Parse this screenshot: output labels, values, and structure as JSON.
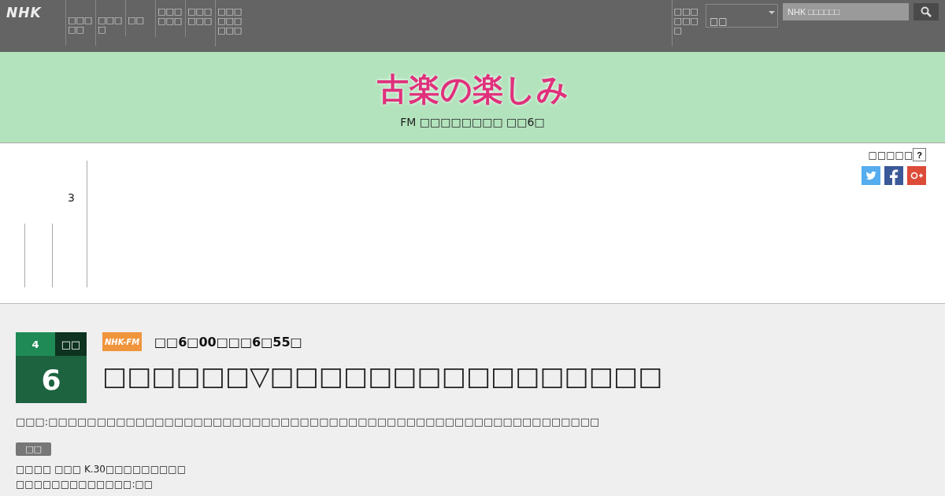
{
  "header": {
    "logo": "NHK",
    "nav": [
      "□□□□□",
      "□□□□",
      "□□",
      "□□□□□□",
      "□□□□□□",
      "□□□□□□□□□"
    ],
    "right_link": "□□□□□□□",
    "select": {
      "value": "□□"
    },
    "search": {
      "placeholder": "NHK □□□□□□"
    }
  },
  "banner": {
    "title": "古楽の楽しみ",
    "schedule": "FM □□□□□□□□ □□6□"
  },
  "share": {
    "label": "□□□□□",
    "help": "?"
  },
  "side": {
    "number": "3"
  },
  "program": {
    "month": "4",
    "weekday": "□□",
    "day": "6",
    "channel": "NHK-FM",
    "time": "□□6□00□□□6□55□",
    "title": "□□□□□□▽□□□□□□□□□□□□□□□□",
    "description": "□□□:□□□□□□□□□□□□□□□□□□□□□□□□□□□□□□□□□□□□□□□□□□□□□□□□□□□□□□□□□",
    "tag": "□□",
    "details": [
      "□□□□ □□□ K.30□□□□□□□□□",
      "□□□□□□□□□□□□□:□□"
    ]
  }
}
